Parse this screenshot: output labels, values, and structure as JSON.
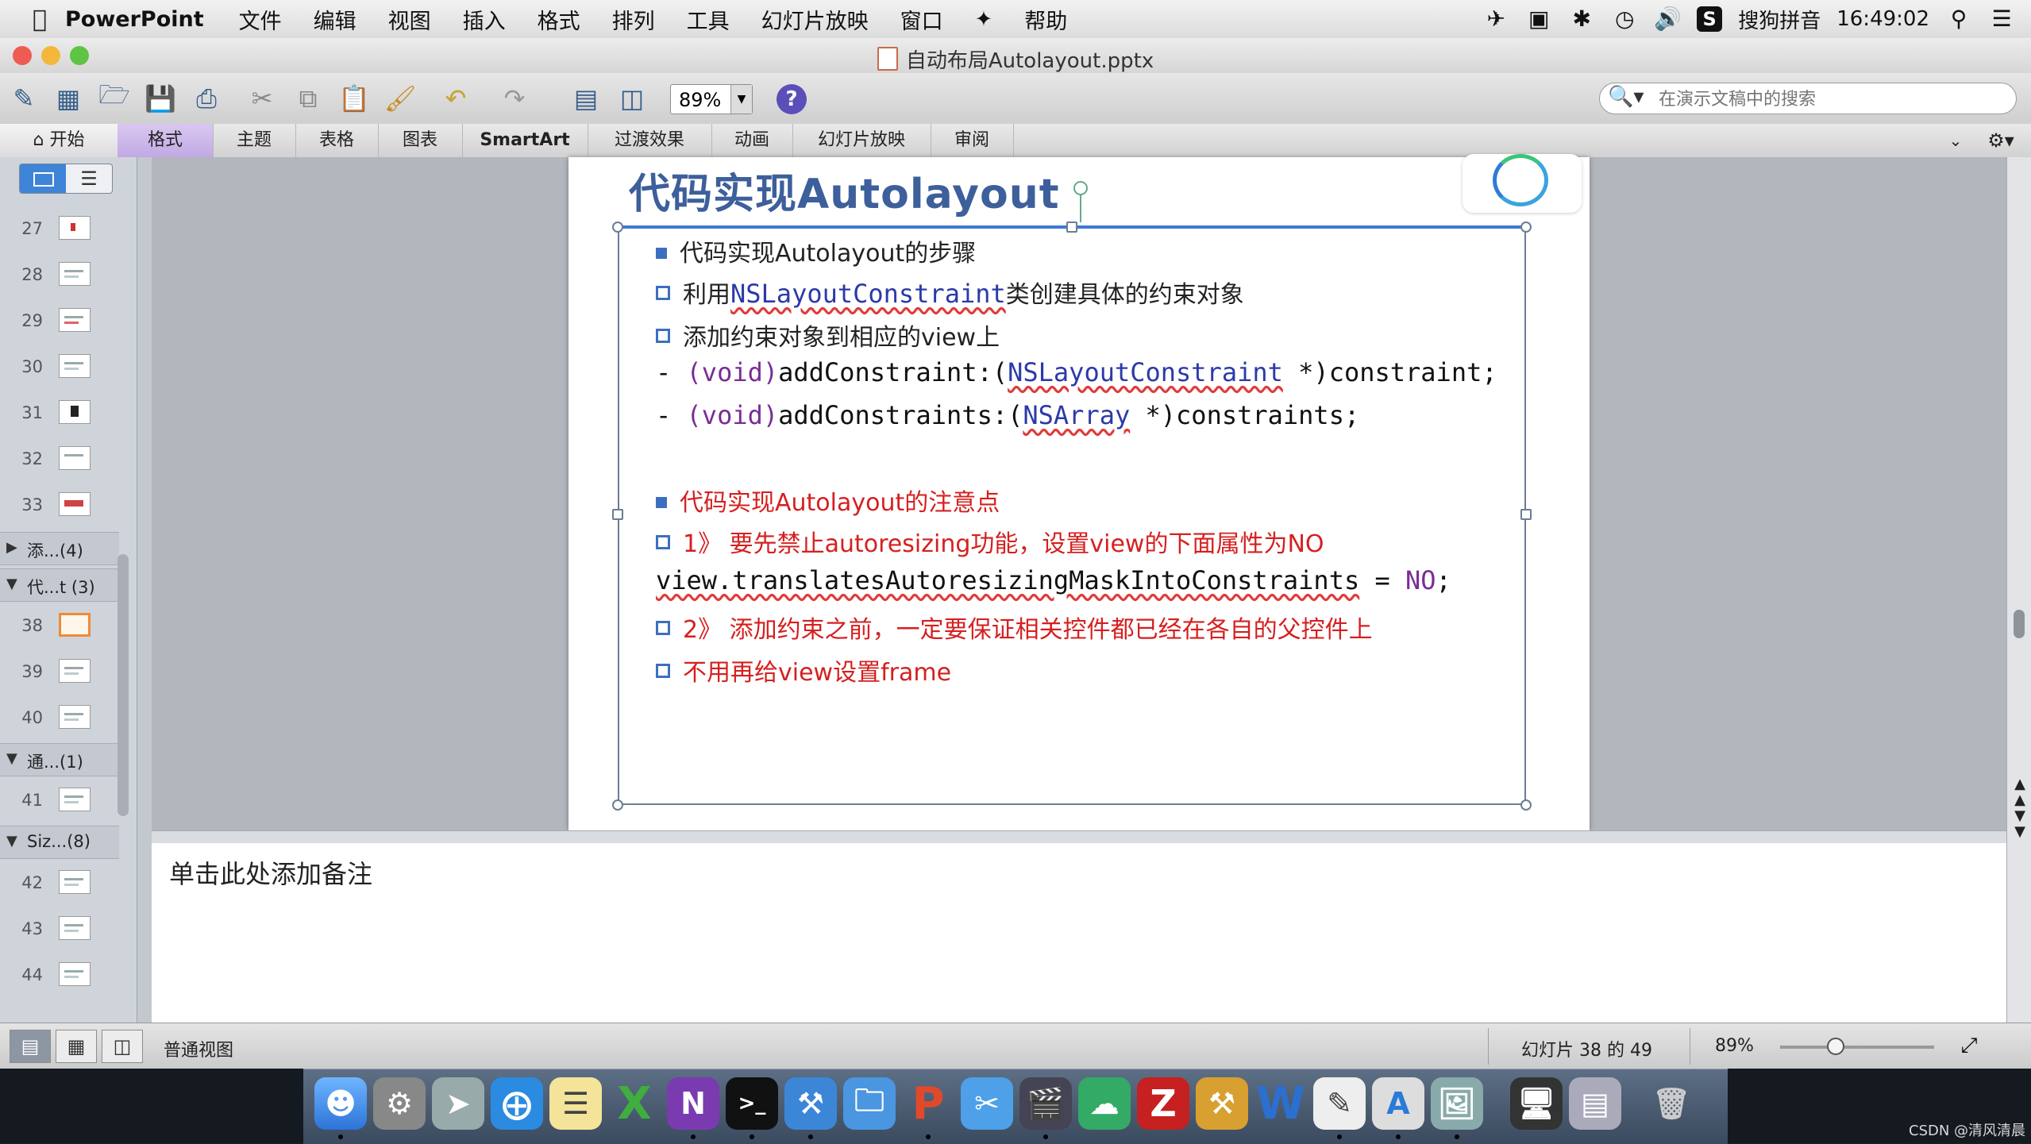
{
  "menubar": {
    "app_name": "PowerPoint",
    "items": [
      "文件",
      "编辑",
      "视图",
      "插入",
      "格式",
      "排列",
      "工具",
      "幻灯片放映",
      "窗口",
      "帮助"
    ],
    "input_method": "搜狗拼音",
    "time": "16:49:02"
  },
  "window": {
    "title": "自动布局Autolayout.pptx"
  },
  "toolbar": {
    "zoom_value": "89%",
    "search_placeholder": "在演示文稿中的搜索"
  },
  "ribbon": {
    "tabs": [
      "开始",
      "格式",
      "主题",
      "表格",
      "图表",
      "SmartArt",
      "过渡效果",
      "动画",
      "幻灯片放映",
      "审阅"
    ],
    "active_index": 1
  },
  "sidebar": {
    "slides_a": [
      "27",
      "28",
      "29",
      "30",
      "31",
      "32",
      "33"
    ],
    "section_1": "添...(4)",
    "section_2": "代...t (3)",
    "slides_b": [
      "38",
      "39",
      "40"
    ],
    "section_3": "通...(1)",
    "slides_c": [
      "41"
    ],
    "section_4": "Siz...(8)",
    "slides_d": [
      "42",
      "43",
      "44"
    ],
    "selected_slide": "38"
  },
  "slide": {
    "title": "代码实现Autolayout",
    "lines": {
      "l1": "代码实现Autolayout的步骤",
      "l2_pre": "利用",
      "l2_code": "NSLayoutConstraint",
      "l2_post": "类创建具体的约束对象",
      "l3": "添加约束对象到相应的view上",
      "l4_dash": "- ",
      "l4_void": "(void)",
      "l4_method": "addConstraint:(",
      "l4_class": "NSLayoutConstraint",
      "l4_rest": " *)constraint;",
      "l5_dash": "- ",
      "l5_void": "(void)",
      "l5_method": "addConstraints:(",
      "l5_class": "NSArray",
      "l5_rest": " *)constraints;",
      "l6": "代码实现Autolayout的注意点",
      "l7": "1》 要先禁止autoresizing功能，设置view的下面属性为NO",
      "l8_code": "view.translatesAutoresizingMaskIntoConstraints",
      "l8_eq": " = ",
      "l8_no": "NO",
      "l8_semi": ";",
      "l9": "2》 添加约束之前，一定要保证相关控件都已经在各自的父控件上",
      "l10": "不用再给view设置frame"
    }
  },
  "notes": {
    "placeholder": "单击此处添加备注"
  },
  "statusbar": {
    "view_name": "普通视图",
    "slide_position": "幻灯片 38 的 49",
    "zoom": "89%",
    "zoom_level": 0.36
  },
  "dock_icons": [
    "finder-icon",
    "system-preferences-icon",
    "launchpad-icon",
    "safari-icon",
    "notes-icon",
    "excel-icon",
    "onenote-icon",
    "terminal-icon",
    "xcode-icon",
    "folder-icon",
    "powerpoint-icon",
    "scissors-icon",
    "video-icon",
    "network-icon",
    "filezilla-icon",
    "tools-icon",
    "word-icon",
    "textedit-icon",
    "app-store-icon",
    "preview-icon",
    "display-icon",
    "screen-icon",
    "trash-icon"
  ],
  "watermark": "CSDN @清风清晨",
  "colors": {
    "accent_blue": "#3d6fc0",
    "title_blue": "#3d5f9b",
    "warning_red": "#d61f1f",
    "selected_thumb": "#ef8a3a",
    "active_tab": "#c1a9e4"
  }
}
